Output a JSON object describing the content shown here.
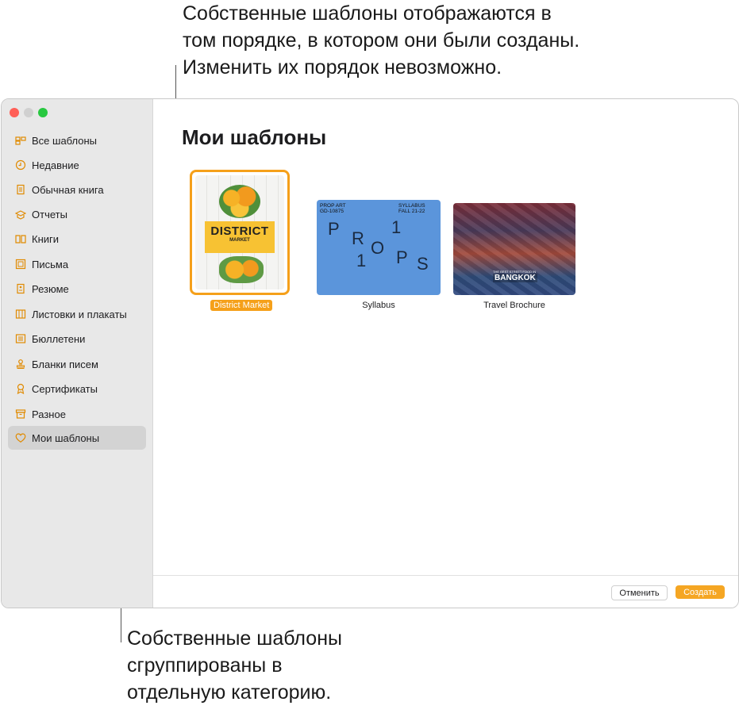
{
  "callouts": {
    "top": "Собственные шаблоны отображаются в\nтом порядке, в котором они были созданы.\nИзменить их порядок невозможно.",
    "bottom": "Собственные шаблоны\nсгруппированы в\nотдельную категорию."
  },
  "sidebar": {
    "items": [
      {
        "label": "Все шаблоны",
        "icon": "grid-icon"
      },
      {
        "label": "Недавние",
        "icon": "clock-icon"
      },
      {
        "label": "Обычная книга",
        "icon": "book-page-icon"
      },
      {
        "label": "Отчеты",
        "icon": "report-icon"
      },
      {
        "label": "Книги",
        "icon": "open-book-icon"
      },
      {
        "label": "Письма",
        "icon": "letter-icon"
      },
      {
        "label": "Резюме",
        "icon": "resume-icon"
      },
      {
        "label": "Листовки и плакаты",
        "icon": "flyer-icon"
      },
      {
        "label": "Бюллетени",
        "icon": "newsletter-icon"
      },
      {
        "label": "Бланки писем",
        "icon": "stamp-icon"
      },
      {
        "label": "Сертификаты",
        "icon": "ribbon-icon"
      },
      {
        "label": "Разное",
        "icon": "archive-icon"
      },
      {
        "label": "Мои шаблоны",
        "icon": "heart-icon",
        "selected": true
      }
    ]
  },
  "main": {
    "title": "Мои шаблоны",
    "templates": [
      {
        "name": "District Market",
        "selected": true,
        "cover": {
          "title": "DISTRICT",
          "subtitle": "MARKET"
        }
      },
      {
        "name": "Syllabus",
        "cover": {
          "top_left_1": "PROP ART",
          "top_left_2": "GD-10875",
          "top_right_1": "SYLLABUS",
          "top_right_2": "FALL 21-22"
        }
      },
      {
        "name": "Travel Brochure",
        "cover": {
          "small": "THE BEST STREET FOOD IN",
          "title": "BANGKOK"
        }
      }
    ]
  },
  "footer": {
    "cancel_label": "Отменить",
    "create_label": "Создать"
  },
  "colors": {
    "accent": "#f5a623",
    "selection": "#f59e0b",
    "sidebar_bg": "#e8e8e8",
    "syllabus_blue": "#5b95db"
  }
}
